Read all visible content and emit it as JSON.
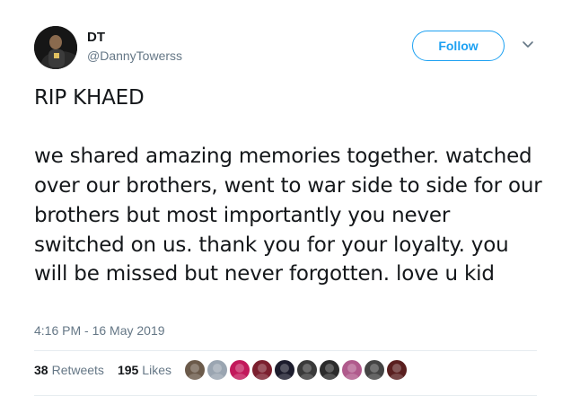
{
  "user": {
    "display_name": "DT",
    "handle": "@DannyTowerss",
    "avatar_icon": "profile-photo-avatar"
  },
  "follow_button": {
    "label": "Follow",
    "color": "#1da1f2"
  },
  "more_menu": {
    "icon": "chevron-down-icon"
  },
  "tweet": {
    "text": "RIP KHAED\n\nwe shared amazing memories together. watched over our brothers, went to war side to side for our brothers but most importantly you never switched on us. thank you for your loyalty. you will be missed but never forgotten. love u kid",
    "timestamp": "4:16 PM - 16 May 2019"
  },
  "stats": {
    "retweets_count": "38",
    "retweets_label": "Retweets",
    "likes_count": "195",
    "likes_label": "Likes"
  },
  "liker_avatars": [
    {
      "name": "liker-avatar-1",
      "color": "#6b5a4a"
    },
    {
      "name": "liker-avatar-2",
      "color": "#9aa5b1"
    },
    {
      "name": "liker-avatar-3",
      "color": "#c2185b"
    },
    {
      "name": "liker-avatar-4",
      "color": "#7b1f2e"
    },
    {
      "name": "liker-avatar-5",
      "color": "#1c1c2c"
    },
    {
      "name": "liker-avatar-6",
      "color": "#3a3a3a"
    },
    {
      "name": "liker-avatar-7",
      "color": "#2b2b2b"
    },
    {
      "name": "liker-avatar-8",
      "color": "#b05a8c"
    },
    {
      "name": "liker-avatar-9",
      "color": "#444444"
    },
    {
      "name": "liker-avatar-10",
      "color": "#5a1f1f"
    }
  ],
  "colors": {
    "text_primary": "#14171a",
    "text_secondary": "#657786",
    "divider": "#e6ecf0"
  }
}
